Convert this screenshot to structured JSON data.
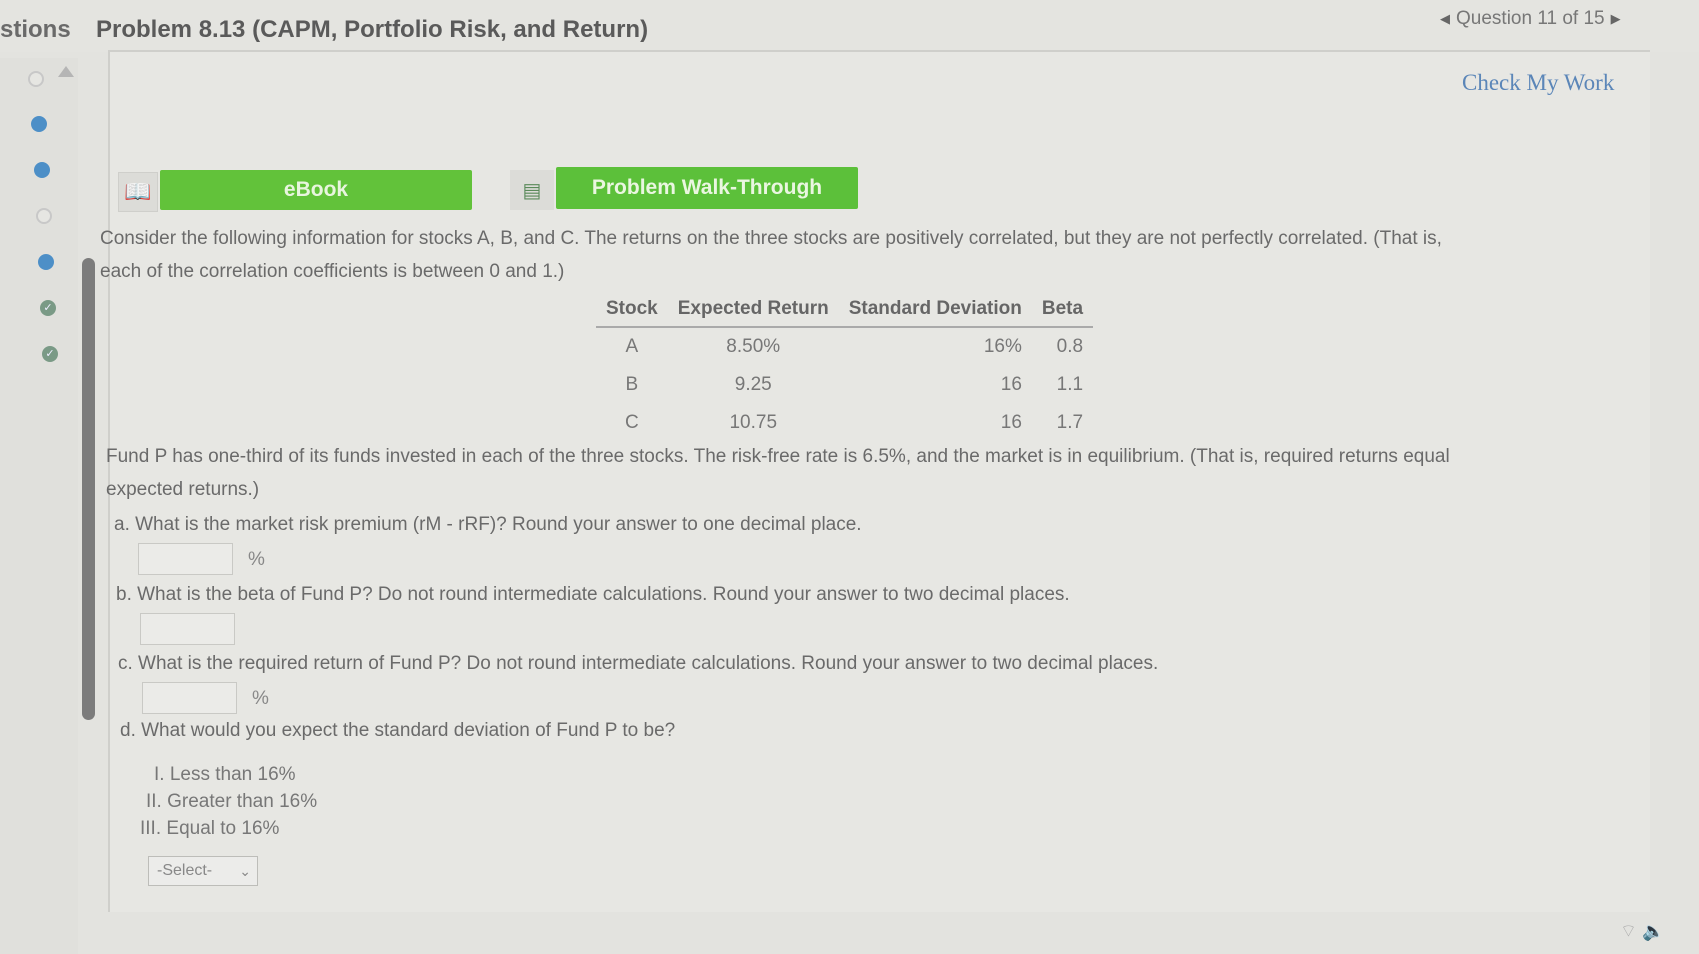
{
  "header": {
    "tab_fragment": "stions",
    "title": "Problem 8.13 (CAPM, Portfolio Risk, and Return)",
    "question_nav": "Question 11 of 15"
  },
  "actions": {
    "check_my_work": "Check My Work",
    "ebook": "eBook",
    "walkthrough": "Problem Walk-Through"
  },
  "intro": {
    "line1": "Consider the following information for stocks A, B, and C. The returns on the three stocks are positively correlated, but they are not perfectly correlated. (That is,",
    "line2": "each of the correlation coefficients is between 0 and 1.)"
  },
  "table": {
    "headers": [
      "Stock",
      "Expected Return",
      "Standard Deviation",
      "Beta"
    ],
    "rows": [
      [
        "A",
        "8.50%",
        "16%",
        "0.8"
      ],
      [
        "B",
        "9.25",
        "16",
        "1.1"
      ],
      [
        "C",
        "10.75",
        "16",
        "1.7"
      ]
    ]
  },
  "fund": {
    "line1": "Fund P has one-third of its funds invested in each of the three stocks. The risk-free rate is 6.5%, and the market is in equilibrium. (That is, required returns equal",
    "line2": "expected returns.)"
  },
  "questions": {
    "a": "a. What is the market risk premium (rM - rRF)? Round your answer to one decimal place.",
    "b": "b. What is the beta of Fund P? Do not round intermediate calculations. Round your answer to two decimal places.",
    "c": "c. What is the required return of Fund P? Do not round intermediate calculations. Round your answer to two decimal places.",
    "d": "d. What would you expect the standard deviation of Fund P to be?"
  },
  "units": {
    "percent": "%"
  },
  "options": [
    "I. Less than 16%",
    "II. Greater than 16%",
    "III. Equal to 16%"
  ],
  "select": {
    "value": "-Select-"
  }
}
